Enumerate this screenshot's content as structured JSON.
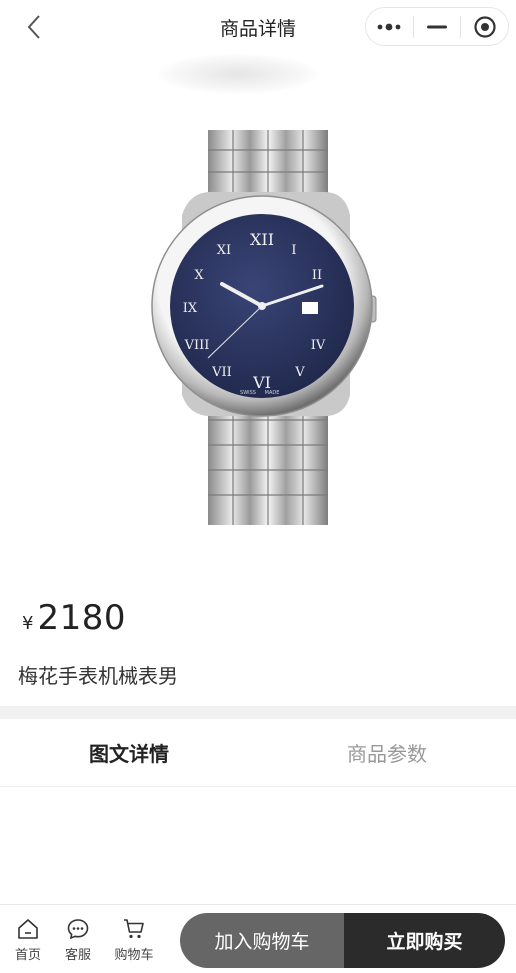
{
  "nav": {
    "title": "商品详情",
    "back_icon": "chevron-left-icon",
    "capsule": [
      "more-dots-icon",
      "minimize-icon",
      "target-close-icon"
    ]
  },
  "product": {
    "image_icon": "wristwatch-image",
    "currency": "¥",
    "price": "2180",
    "name": "梅花手表机械表男",
    "watch_text": {
      "brand_left": "SWISS",
      "brand_right": "MADE"
    }
  },
  "tabs": [
    {
      "label": "图文详情",
      "active": true
    },
    {
      "label": "商品参数",
      "active": false
    }
  ],
  "bottom_bar": {
    "home": "首页",
    "service": "客服",
    "cart": "购物车",
    "add_to_cart": "加入购物车",
    "buy_now": "立即购买"
  },
  "colors": {
    "dial": "#27325c",
    "add_button": "#666666",
    "buy_button": "#2b2b2b"
  }
}
